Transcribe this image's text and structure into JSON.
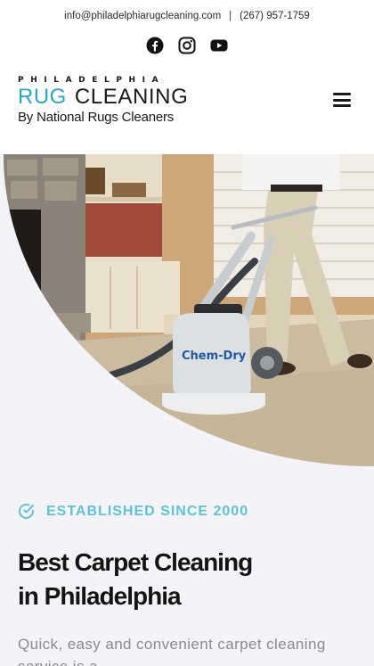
{
  "contact": {
    "email": "info@philadelphiarugcleaning.com",
    "separator": "|",
    "phone": "(267) 957-1759"
  },
  "social": [
    "facebook-icon",
    "instagram-icon",
    "youtube-icon"
  ],
  "logo": {
    "tagline": "PHILADELPHIA",
    "word1": "RUG",
    "word2": "CLEANING",
    "sub": "By National Rugs Cleaners"
  },
  "hero": {
    "machine_brand": "Chem-Dry"
  },
  "badge": {
    "icon": "check-circle-icon",
    "text": "ESTABLISHED SINCE 2000"
  },
  "title": {
    "line1": "Best Carpet Cleaning",
    "line2": "in Philadelphia"
  },
  "intro": "Quick, easy and convenient carpet cleaning service is a",
  "colors": {
    "accent": "#2aa6c8",
    "badge": "#5fc2da",
    "background": "#f3f3f8"
  }
}
